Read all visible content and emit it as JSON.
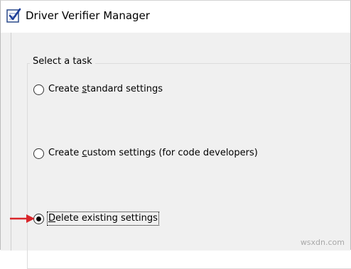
{
  "window": {
    "title": "Driver Verifier Manager",
    "icon": "driver-verifier-checklist-icon"
  },
  "task_group": {
    "title": "Select a task",
    "options": [
      {
        "prefix": "Create ",
        "mnemonic": "s",
        "suffix": "tandard settings",
        "checked": false
      },
      {
        "prefix": "Create ",
        "mnemonic": "c",
        "suffix": "ustom settings (for code developers)",
        "checked": false
      },
      {
        "prefix": "",
        "mnemonic": "D",
        "suffix": "elete existing settings",
        "checked": true
      }
    ]
  },
  "annotation": {
    "arrow_icon": "red-arrow-right-icon",
    "arrow_color": "#d9262b"
  },
  "watermark": "wsxdn.com"
}
